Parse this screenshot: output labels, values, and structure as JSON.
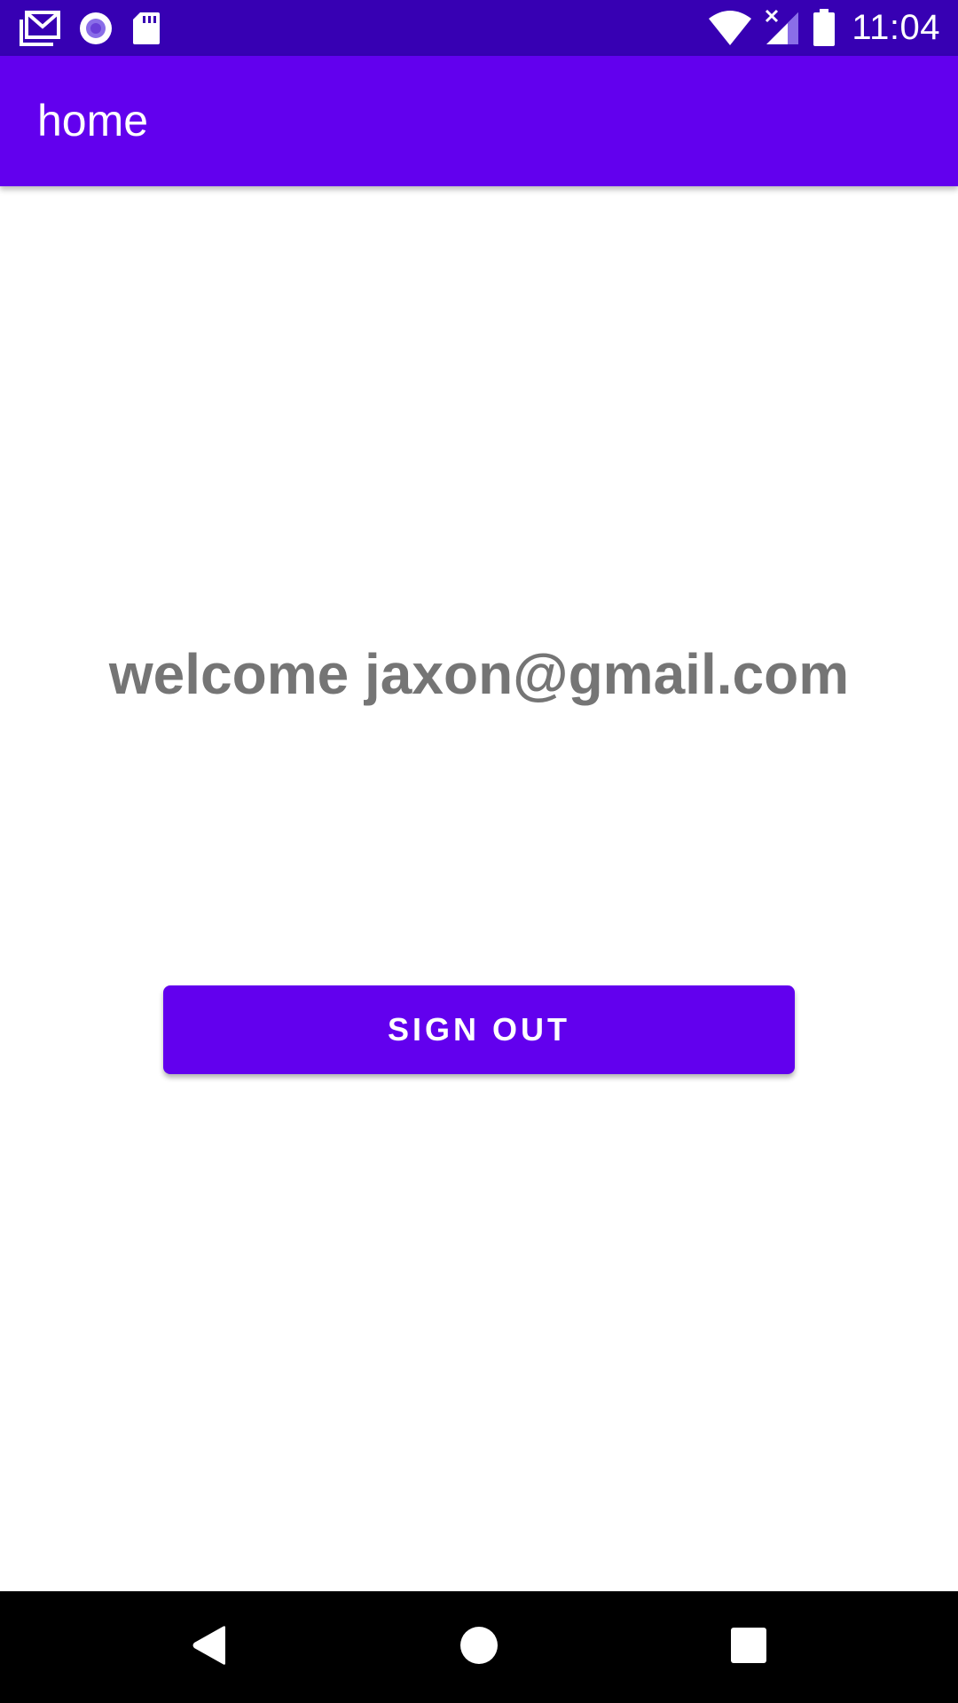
{
  "status_bar": {
    "time": "11:04",
    "left_icons": [
      "gmail-icon",
      "radio-record-icon",
      "sd-card-icon"
    ],
    "right_icons": [
      "wifi-icon",
      "cellular-no-signal-icon",
      "battery-icon"
    ],
    "background_color": "#3700b3"
  },
  "app_bar": {
    "title": "home",
    "background_color": "#6200ee"
  },
  "main": {
    "welcome_text": "welcome jaxon@gmail.com",
    "sign_out_label": "SIGN OUT",
    "button_color": "#6200ee"
  },
  "nav_bar": {
    "items": [
      "back-icon",
      "home-icon",
      "recents-icon"
    ]
  }
}
